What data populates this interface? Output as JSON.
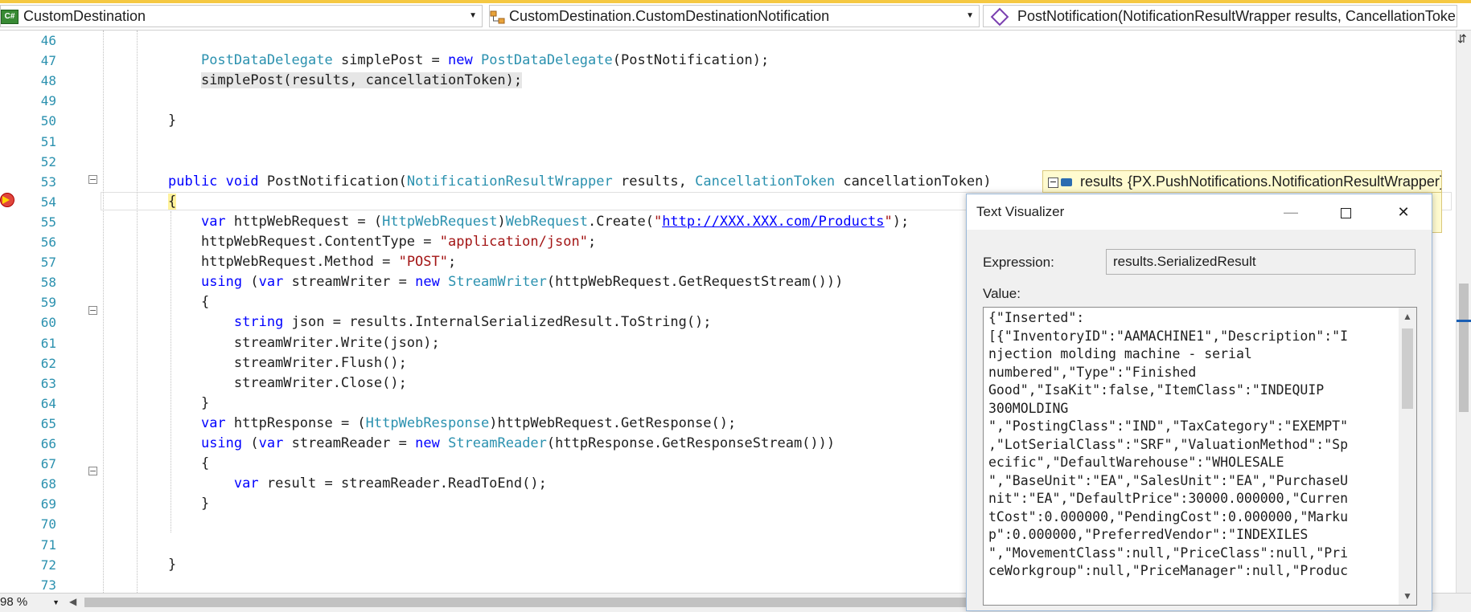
{
  "navbar": {
    "project_combo": "CustomDestination",
    "class_combo": "CustomDestination.CustomDestinationNotification",
    "member_combo": "PostNotification(NotificationResultWrapper results, CancellationToken c"
  },
  "editor": {
    "lines": [
      {
        "num": "46",
        "html": ""
      },
      {
        "num": "47",
        "html": "    <span class=\"ty\">PostDataDelegate</span> simplePost = <span class=\"kw\">new</span> <span class=\"ty\">PostDataDelegate</span>(PostNotification);"
      },
      {
        "num": "48",
        "html": "    <span class=\"hl\">simplePost(results, cancellationToken);</span>"
      },
      {
        "num": "49",
        "html": ""
      },
      {
        "num": "50",
        "html": "}"
      },
      {
        "num": "51",
        "html": ""
      },
      {
        "num": "52",
        "html": ""
      },
      {
        "num": "53",
        "html": "<span class=\"kw\">public</span> <span class=\"kw\">void</span> PostNotification(<span class=\"ty\">NotificationResultWrapper</span> results, <span class=\"ty\">CancellationToken</span> cancellationToken)"
      },
      {
        "num": "54",
        "html": "<span class=\"brace-hl\">{</span>"
      },
      {
        "num": "55",
        "html": "    <span class=\"kw\">var</span> httpWebRequest = (<span class=\"ty\">HttpWebRequest</span>)<span class=\"ty\">WebRequest</span>.Create(<span class=\"st\">\"</span><span class=\"url\">http://XXX.XXX.com/Products</span><span class=\"st\">\"</span>);"
      },
      {
        "num": "56",
        "html": "    httpWebRequest.ContentType = <span class=\"st\">\"application/json\"</span>;"
      },
      {
        "num": "57",
        "html": "    httpWebRequest.Method = <span class=\"st\">\"POST\"</span>;"
      },
      {
        "num": "58",
        "html": "    <span class=\"kw\">using</span> (<span class=\"kw\">var</span> streamWriter = <span class=\"kw\">new</span> <span class=\"ty\">StreamWriter</span>(httpWebRequest.GetRequestStream()))"
      },
      {
        "num": "59",
        "html": "    {"
      },
      {
        "num": "60",
        "html": "        <span class=\"kw\">string</span> json = results.InternalSerializedResult.ToString();"
      },
      {
        "num": "61",
        "html": "        streamWriter.Write(json);"
      },
      {
        "num": "62",
        "html": "        streamWriter.Flush();"
      },
      {
        "num": "63",
        "html": "        streamWriter.Close();"
      },
      {
        "num": "64",
        "html": "    }"
      },
      {
        "num": "65",
        "html": "    <span class=\"kw\">var</span> httpResponse = (<span class=\"ty\">HttpWebResponse</span>)httpWebRequest.GetResponse();"
      },
      {
        "num": "66",
        "html": "    <span class=\"kw\">using</span> (<span class=\"kw\">var</span> streamReader = <span class=\"kw\">new</span> <span class=\"ty\">StreamReader</span>(httpResponse.GetResponseStream()))"
      },
      {
        "num": "67",
        "html": "    {"
      },
      {
        "num": "68",
        "html": "        <span class=\"kw\">var</span> result = streamReader.ReadToEnd();"
      },
      {
        "num": "69",
        "html": "    }"
      },
      {
        "num": "70",
        "html": ""
      },
      {
        "num": "71",
        "html": ""
      },
      {
        "num": "72",
        "html": "}"
      },
      {
        "num": "73",
        "html": ""
      }
    ]
  },
  "statusbar": {
    "zoom": "98 %"
  },
  "datatip": {
    "name": "results",
    "value": "{PX.PushNotifications.NotificationResultWrapper}"
  },
  "dialog": {
    "title": "Text Visualizer",
    "expression_label": "Expression:",
    "expression_value": "results.SerializedResult",
    "value_label": "Value:",
    "value_text": "{\"Inserted\":\n[{\"InventoryID\":\"AAMACHINE1\",\"Description\":\"I\nnjection molding machine - serial\nnumbered\",\"Type\":\"Finished\nGood\",\"IsaKit\":false,\"ItemClass\":\"INDEQUIP\n300MOLDING\n\",\"PostingClass\":\"IND\",\"TaxCategory\":\"EXEMPT\"\n,\"LotSerialClass\":\"SRF\",\"ValuationMethod\":\"Sp\necific\",\"DefaultWarehouse\":\"WHOLESALE\n\",\"BaseUnit\":\"EA\",\"SalesUnit\":\"EA\",\"PurchaseU\nnit\":\"EA\",\"DefaultPrice\":30000.000000,\"Curren\ntCost\":0.000000,\"PendingCost\":0.000000,\"Marku\np\":0.000000,\"PreferredVendor\":\"INDEXILES\n\",\"MovementClass\":null,\"PriceClass\":null,\"Pri\nceWorkgroup\":null,\"PriceManager\":null,\"Produc"
  }
}
